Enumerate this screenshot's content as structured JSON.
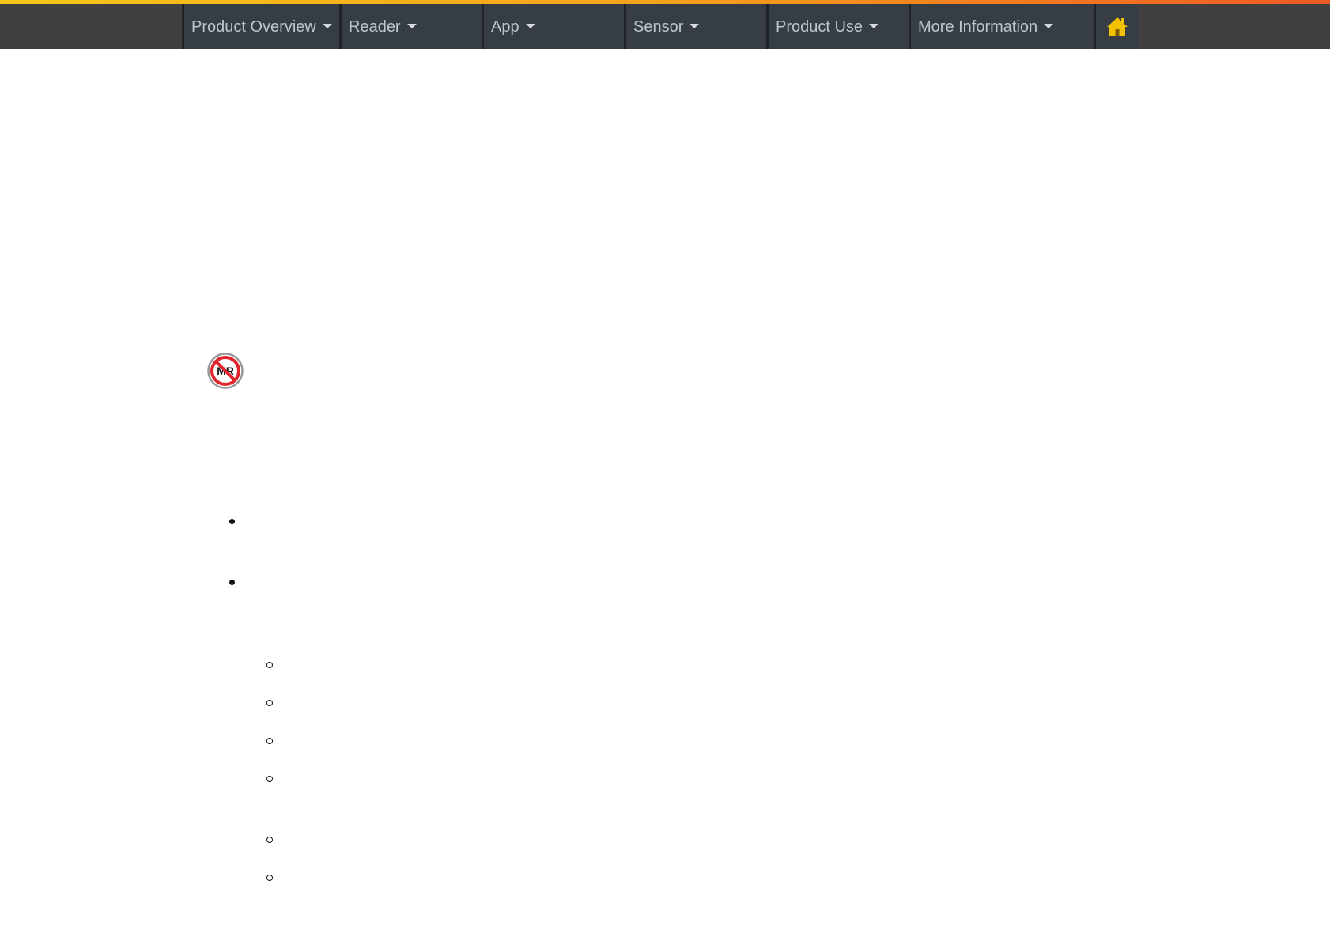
{
  "colors": {
    "accent_start": "#f7c61a",
    "accent_end": "#ee5a24",
    "nav_background": "#363d45",
    "nav_text": "#bfc5cc",
    "home_icon": "#f2c200"
  },
  "nav": {
    "items": [
      {
        "label": "Product Overview",
        "icon": "caret-down-icon"
      },
      {
        "label": "Reader",
        "icon": "caret-down-icon"
      },
      {
        "label": "App",
        "icon": "caret-down-icon"
      },
      {
        "label": "Sensor",
        "icon": "caret-down-icon"
      },
      {
        "label": "Product Use",
        "icon": "caret-down-icon"
      },
      {
        "label": "More Information",
        "icon": "caret-down-icon"
      }
    ],
    "home_icon": "home-icon"
  },
  "content": {
    "mr_icon": "mr-unsafe-icon",
    "mr_icon_text": "MR"
  }
}
